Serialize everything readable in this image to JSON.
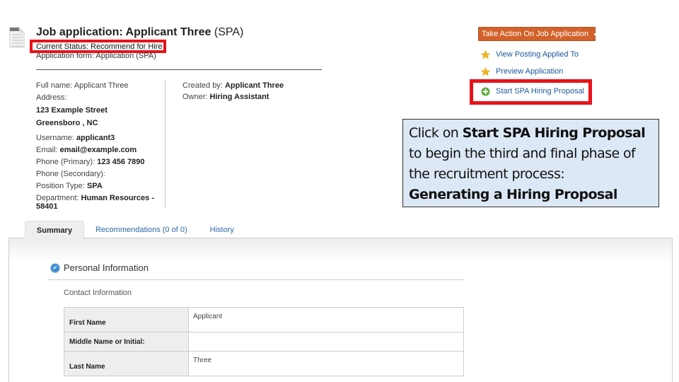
{
  "header": {
    "title": "Job application: Applicant Three",
    "title_suffix": "(SPA)",
    "current_status": "Current Status: Recommend for Hire",
    "application_form": "Application form: Application (SPA)"
  },
  "applicant": {
    "full_name_label": "Full name:",
    "full_name": "Applicant Three",
    "address_label": "Address:",
    "address_line1": "123 Example Street",
    "address_line2": "Greensboro , NC",
    "username_label": "Username:",
    "username": "applicant3",
    "email_label": "Email:",
    "email": "email@example.com",
    "phone_primary_label": "Phone (Primary):",
    "phone_primary": "123 456 7890",
    "phone_secondary_label": "Phone (Secondary):",
    "phone_secondary": "",
    "position_type_label": "Position Type:",
    "position_type": "SPA",
    "department_label": "Department:",
    "department": "Human Resources - 58401",
    "created_by_label": "Created by:",
    "created_by": "Applicant Three",
    "owner_label": "Owner:",
    "owner": "Hiring Assistant"
  },
  "actions": {
    "take_action_label": "Take Action On Job Application",
    "caret": "▼",
    "links": [
      {
        "label": "View Posting Applied To",
        "icon": "star-icon"
      },
      {
        "label": "Preview Application",
        "icon": "star-icon"
      },
      {
        "label": "Start SPA Hiring Proposal",
        "icon": "plus-circle-icon"
      }
    ]
  },
  "callout": {
    "prefix": "Click on ",
    "bold1": "Start SPA Hiring Proposal",
    "middle": " to begin the third and final phase of the recruitment process:",
    "bold2": "Generating a Hiring Proposal"
  },
  "tabs": [
    {
      "label": "Summary",
      "active": true
    },
    {
      "label": "Recommendations (0 of 0)",
      "active": false
    },
    {
      "label": "History",
      "active": false
    }
  ],
  "summary": {
    "section_title": "Personal Information",
    "subsection_title": "Contact Information",
    "rows": [
      {
        "label": "First Name",
        "value": "Applicant"
      },
      {
        "label": "Middle Name or Initial:",
        "value": ""
      },
      {
        "label": "Last Name",
        "value": "Three"
      }
    ]
  },
  "colors": {
    "highlight_red": "#e8121a",
    "action_orange": "#d2622a",
    "link_blue": "#1a5a9a",
    "callout_bg": "#dce8f5"
  }
}
